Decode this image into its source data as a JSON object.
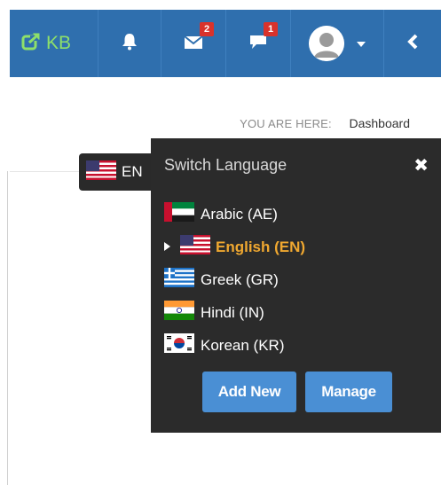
{
  "topbar": {
    "brand_label": "KB",
    "brand_color": "#8ee06a",
    "bar_color": "#2f6fae",
    "icons": {
      "brand": "external-link-icon",
      "bell": "bell-icon",
      "mail": "envelope-icon",
      "chat": "comment-icon",
      "avatar": "user-avatar",
      "caret": "caret-down-icon",
      "back": "chevron-left-icon"
    },
    "mail_badge": "2",
    "chat_badge": "1"
  },
  "breadcrumb": {
    "prefix": "YOU ARE HERE:",
    "current": "Dashboard"
  },
  "language_trigger": {
    "label": "EN",
    "flag": "flag-us"
  },
  "language_panel": {
    "title": "Switch Language",
    "close_icon": "close-x-icon",
    "languages": [
      {
        "label": "Arabic (AE)",
        "flag": "flag-ae",
        "active": false
      },
      {
        "label": "English (EN)",
        "flag": "flag-us",
        "active": true
      },
      {
        "label": "Greek (GR)",
        "flag": "flag-gr",
        "active": false
      },
      {
        "label": "Hindi (IN)",
        "flag": "flag-in",
        "active": false
      },
      {
        "label": "Korean (KR)",
        "flag": "flag-kr",
        "active": false
      }
    ],
    "active_color": "#f0a830",
    "add_new_label": "Add New",
    "manage_label": "Manage",
    "button_color": "#4a8fd4"
  }
}
